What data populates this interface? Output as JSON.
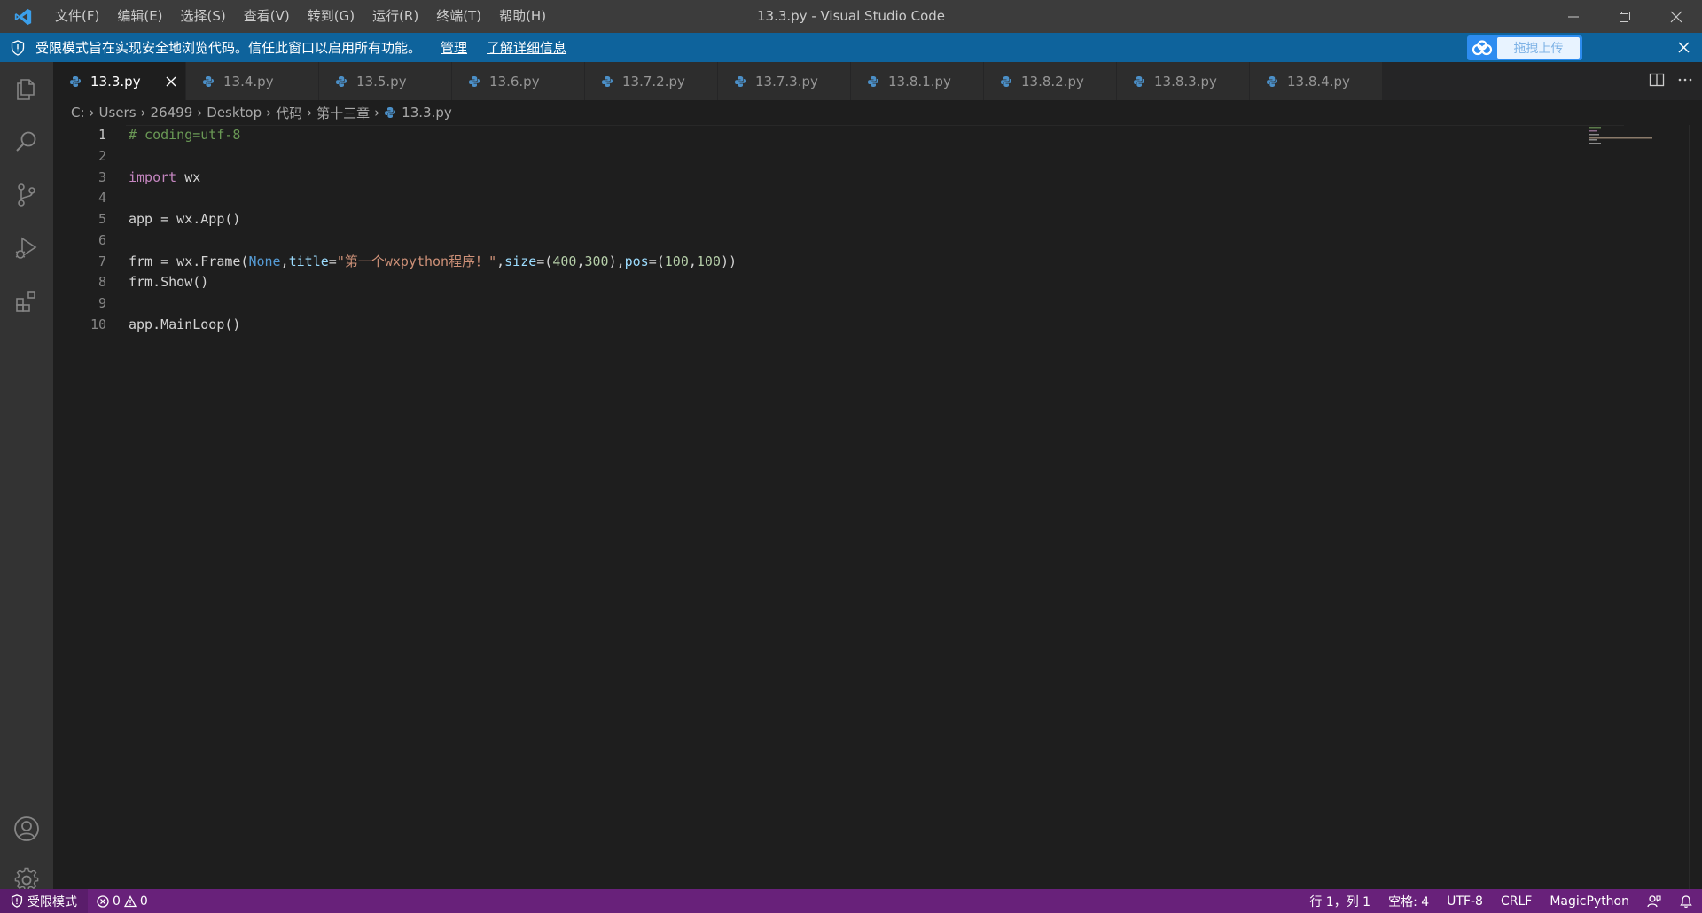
{
  "titlebar": {
    "menu": [
      "文件(F)",
      "编辑(E)",
      "选择(S)",
      "查看(V)",
      "转到(G)",
      "运行(R)",
      "终端(T)",
      "帮助(H)"
    ],
    "title": "13.3.py - Visual Studio Code"
  },
  "banner": {
    "message": "受限模式旨在实现安全地浏览代码。信任此窗口以启用所有功能。",
    "manage": "管理",
    "learn_more": "了解详细信息",
    "upload": "拖拽上传"
  },
  "tabs": [
    "13.3.py",
    "13.4.py",
    "13.5.py",
    "13.6.py",
    "13.7.2.py",
    "13.7.3.py",
    "13.8.1.py",
    "13.8.2.py",
    "13.8.3.py",
    "13.8.4.py"
  ],
  "breadcrumb": [
    "C:",
    "Users",
    "26499",
    "Desktop",
    "代码",
    "第十三章",
    "13.3.py"
  ],
  "editor": {
    "line_numbers": [
      "1",
      "2",
      "3",
      "4",
      "5",
      "6",
      "7",
      "8",
      "9",
      "10"
    ],
    "lines": [
      [
        {
          "t": "# coding=utf-8",
          "c": "comment"
        }
      ],
      [],
      [
        {
          "t": "import",
          "c": "keyword"
        },
        {
          "t": " wx",
          "c": "plain"
        }
      ],
      [],
      [
        {
          "t": "app = wx.App()",
          "c": "plain"
        }
      ],
      [],
      [
        {
          "t": "frm = wx.Frame(",
          "c": "plain"
        },
        {
          "t": "None",
          "c": "const"
        },
        {
          "t": ",",
          "c": "plain"
        },
        {
          "t": "title",
          "c": "param"
        },
        {
          "t": "=",
          "c": "plain"
        },
        {
          "t": "\"第一个wxpython程序！\"",
          "c": "string"
        },
        {
          "t": ",",
          "c": "plain"
        },
        {
          "t": "size",
          "c": "param"
        },
        {
          "t": "=(",
          "c": "plain"
        },
        {
          "t": "400",
          "c": "number"
        },
        {
          "t": ",",
          "c": "plain"
        },
        {
          "t": "300",
          "c": "number"
        },
        {
          "t": "),",
          "c": "plain"
        },
        {
          "t": "pos",
          "c": "param"
        },
        {
          "t": "=(",
          "c": "plain"
        },
        {
          "t": "100",
          "c": "number"
        },
        {
          "t": ",",
          "c": "plain"
        },
        {
          "t": "100",
          "c": "number"
        },
        {
          "t": "))",
          "c": "plain"
        }
      ],
      [
        {
          "t": "frm.Show()",
          "c": "plain"
        }
      ],
      [],
      [
        {
          "t": "app.MainLoop()",
          "c": "plain"
        }
      ]
    ]
  },
  "statusbar": {
    "restricted": "受限模式",
    "errors": "0",
    "warnings": "0",
    "position": "行 1，列 1",
    "spaces": "空格: 4",
    "encoding": "UTF-8",
    "eol": "CRLF",
    "language": "MagicPython"
  },
  "colors": {
    "titlebar": "#3c3c3c",
    "banner": "#0e639c",
    "activitybar": "#333333",
    "editor": "#1e1e1e",
    "statusbar": "#68217a"
  }
}
